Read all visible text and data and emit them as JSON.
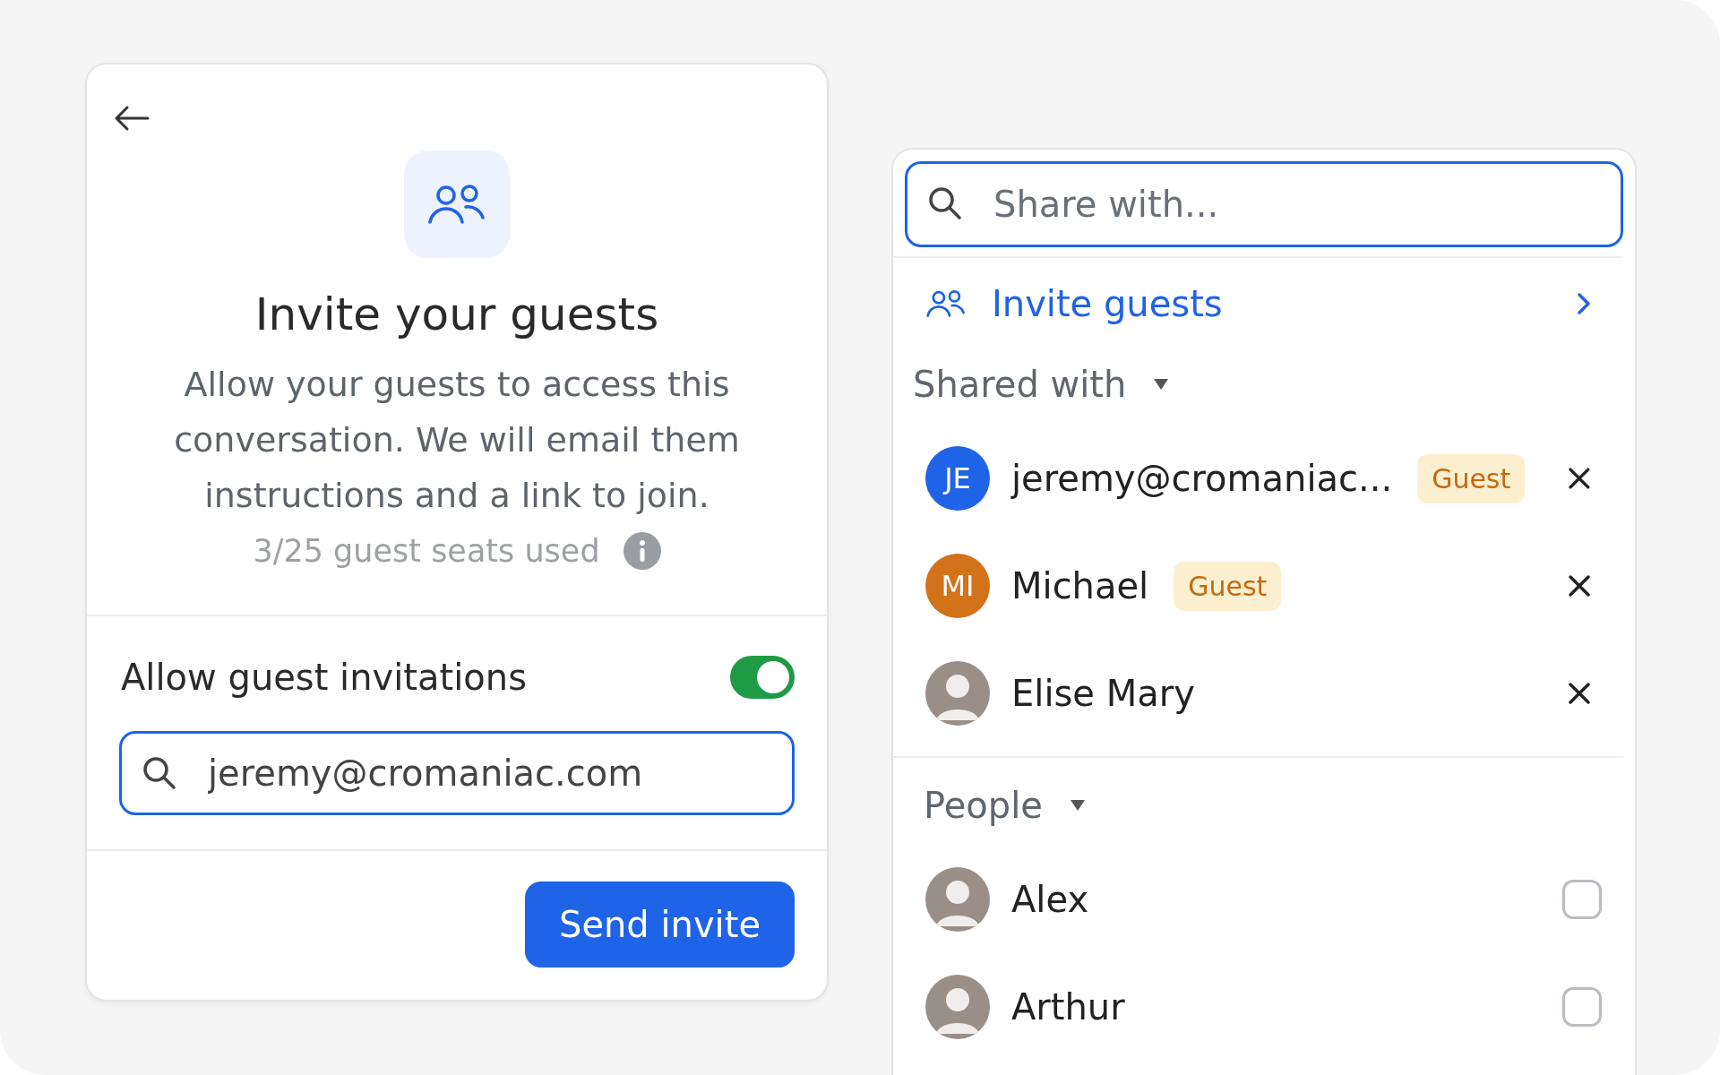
{
  "invite_card": {
    "title": "Invite your guests",
    "description": "Allow your guests to access this conversation. We will email them instructions and a link to join.",
    "seats_used": "3/25 guest seats used",
    "toggle": {
      "label": "Allow guest invitations",
      "on": true
    },
    "email_field": {
      "value": "jeremy@cromaniac.com"
    },
    "send_button": "Send invite"
  },
  "share_panel": {
    "search": {
      "placeholder": "Share with..."
    },
    "invite_link": "Invite guests",
    "shared_with": {
      "label": "Shared with",
      "expanded": true,
      "items": [
        {
          "kind": "initials",
          "initials": "JE",
          "color": "#1f63e6",
          "name": "jeremy@cromaniac...",
          "badge": "Guest"
        },
        {
          "kind": "initials",
          "initials": "MI",
          "color": "#d2721a",
          "name": "Michael",
          "badge": "Guest"
        },
        {
          "kind": "photo",
          "name": "Elise Mary"
        }
      ]
    },
    "people": {
      "label": "People",
      "expanded": true,
      "items": [
        {
          "kind": "photo",
          "name": "Alex",
          "checked": false
        },
        {
          "kind": "photo",
          "name": "Arthur",
          "checked": false
        }
      ]
    }
  }
}
